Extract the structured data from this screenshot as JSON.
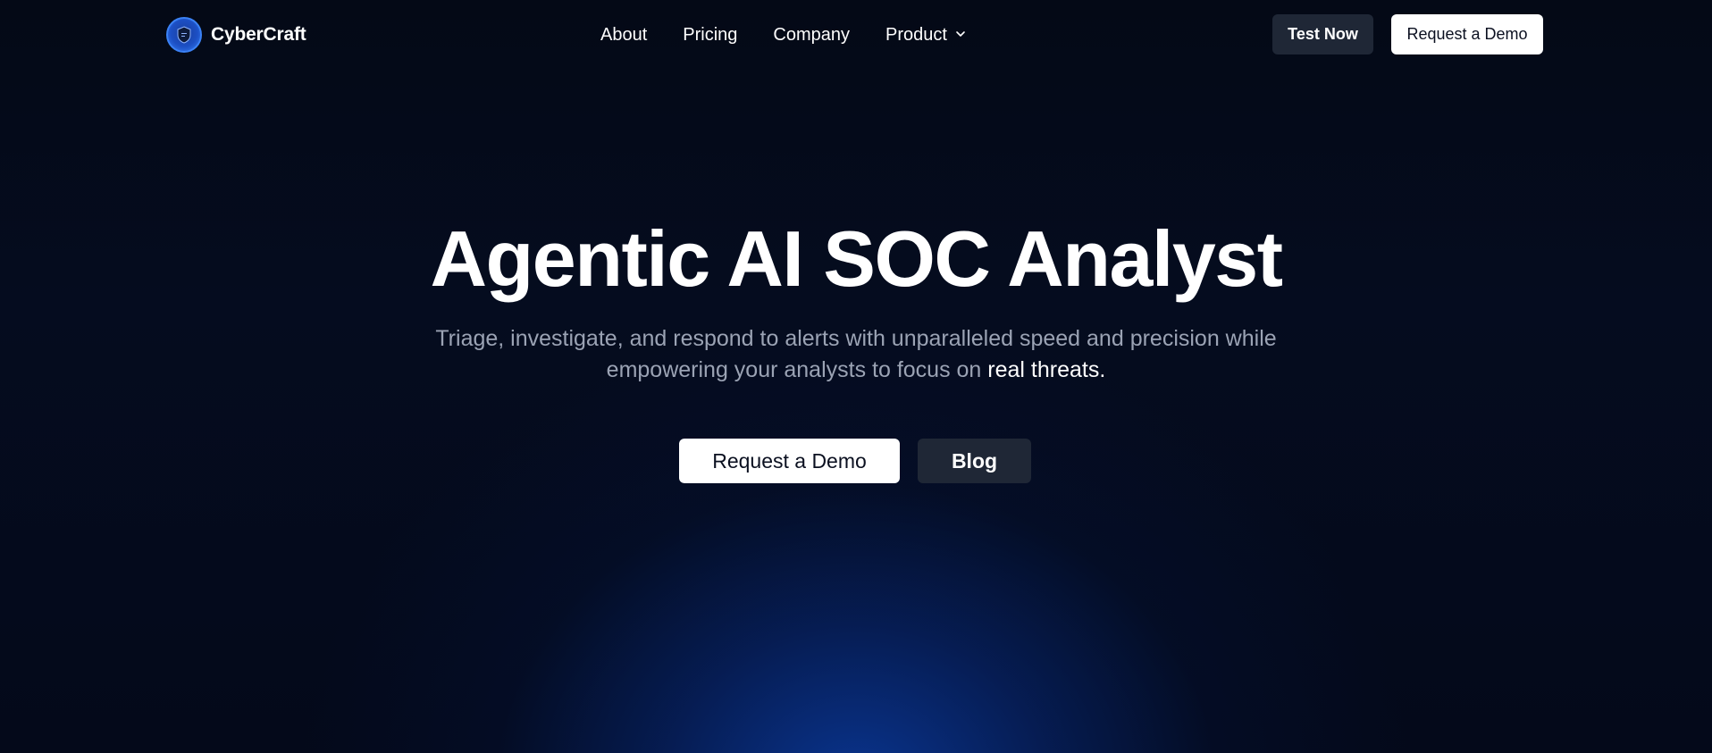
{
  "colors": {
    "background": "#040a1a",
    "glow": "#0a3796",
    "accent": "#3b82f6",
    "secondary_button": "#1f2736",
    "muted_text": "#9ba3b4"
  },
  "brand": {
    "name": "CyberCraft",
    "logo_icon": "shield-logo-icon"
  },
  "nav": {
    "links": [
      {
        "label": "About"
      },
      {
        "label": "Pricing"
      },
      {
        "label": "Company"
      },
      {
        "label": "Product",
        "icon": "chevron-down-icon"
      }
    ],
    "test_now_label": "Test Now",
    "request_demo_label": "Request a Demo"
  },
  "hero": {
    "title": "Agentic AI SOC Analyst",
    "subtitle_line1": "Triage, investigate, and respond to alerts with unparalleled speed and precision while",
    "subtitle_line2_prefix": "empowering your analysts to focus on ",
    "subtitle_highlight": "real threats.",
    "primary_button": "Request a Demo",
    "secondary_button": "Blog"
  }
}
